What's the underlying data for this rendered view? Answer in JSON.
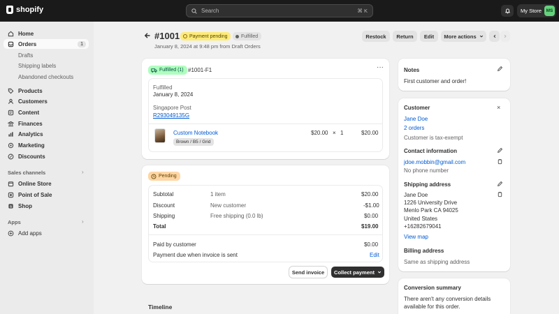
{
  "topbar": {
    "brand": "shopify",
    "search_placeholder": "Search",
    "search_shortcut": "⌘ K",
    "store_name": "My Store",
    "store_initials": "MS"
  },
  "sidebar": {
    "items": [
      {
        "label": "Home"
      },
      {
        "label": "Orders",
        "count": "1"
      },
      {
        "label": "Drafts"
      },
      {
        "label": "Shipping labels"
      },
      {
        "label": "Abandoned checkouts"
      },
      {
        "label": "Products"
      },
      {
        "label": "Customers"
      },
      {
        "label": "Content"
      },
      {
        "label": "Finances"
      },
      {
        "label": "Analytics"
      },
      {
        "label": "Marketing"
      },
      {
        "label": "Discounts"
      }
    ],
    "sales_channels_label": "Sales channels",
    "channels": [
      "Online Store",
      "Point of Sale",
      "Shop"
    ],
    "apps_label": "Apps",
    "add_apps": "Add apps"
  },
  "header": {
    "order_number": "#1001",
    "payment_status": "Payment pending",
    "fulfillment_status": "Fulfilled",
    "subtitle": "January 8, 2024 at 9:48 pm from Draft Orders",
    "buttons": {
      "restock": "Restock",
      "return": "Return",
      "edit": "Edit",
      "more": "More actions"
    }
  },
  "fulfillment": {
    "badge": "Fulfilled (1)",
    "id": "#1001-F1",
    "status_label": "Fulfilled",
    "date": "January 8, 2024",
    "carrier": "Singapore Post",
    "tracking": "R293049135G",
    "item": {
      "name": "Custom Notebook",
      "variant": "Brown / B5 / Grid",
      "price": "$20.00",
      "times": "×",
      "qty": "1",
      "total": "$20.00"
    }
  },
  "payment": {
    "badge": "Pending",
    "rows": [
      {
        "label": "Subtotal",
        "desc": "1 item",
        "amount": "$20.00"
      },
      {
        "label": "Discount",
        "desc": "New customer",
        "amount": "-$1.00"
      },
      {
        "label": "Shipping",
        "desc": "Free shipping (0.0 lb)",
        "amount": "$0.00"
      },
      {
        "label": "Total",
        "desc": "",
        "amount": "$19.00"
      }
    ],
    "paid_label": "Paid by customer",
    "paid_amount": "$0.00",
    "due_label": "Payment due when invoice is sent",
    "due_edit": "Edit",
    "send_invoice": "Send invoice",
    "collect_payment": "Collect payment"
  },
  "timeline": {
    "title": "Timeline"
  },
  "notes": {
    "title": "Notes",
    "text": "First customer and order!"
  },
  "customer": {
    "title": "Customer",
    "name": "Jane Doe",
    "orders": "2 orders",
    "tax": "Customer is tax-exempt",
    "contact_title": "Contact information",
    "email": "jdoe.mobbin@gmail.com",
    "phone": "No phone number",
    "shipping_title": "Shipping address",
    "address": [
      "Jane Doe",
      "1226 University Drive",
      "Menlo Park CA 94025",
      "United States",
      "+16282679041"
    ],
    "view_map": "View map",
    "billing_title": "Billing address",
    "billing": "Same as shipping address"
  },
  "conversion": {
    "title": "Conversion summary",
    "line1": "There aren't any conversion details",
    "line2": "available for this order."
  },
  "colors": {
    "topbar": "#1a1a1a",
    "accent_link": "#005bd3",
    "payment_pending": "#ffeb78",
    "fulfilled_green": "#affebf",
    "pending_orange": "#ffd6a4"
  }
}
